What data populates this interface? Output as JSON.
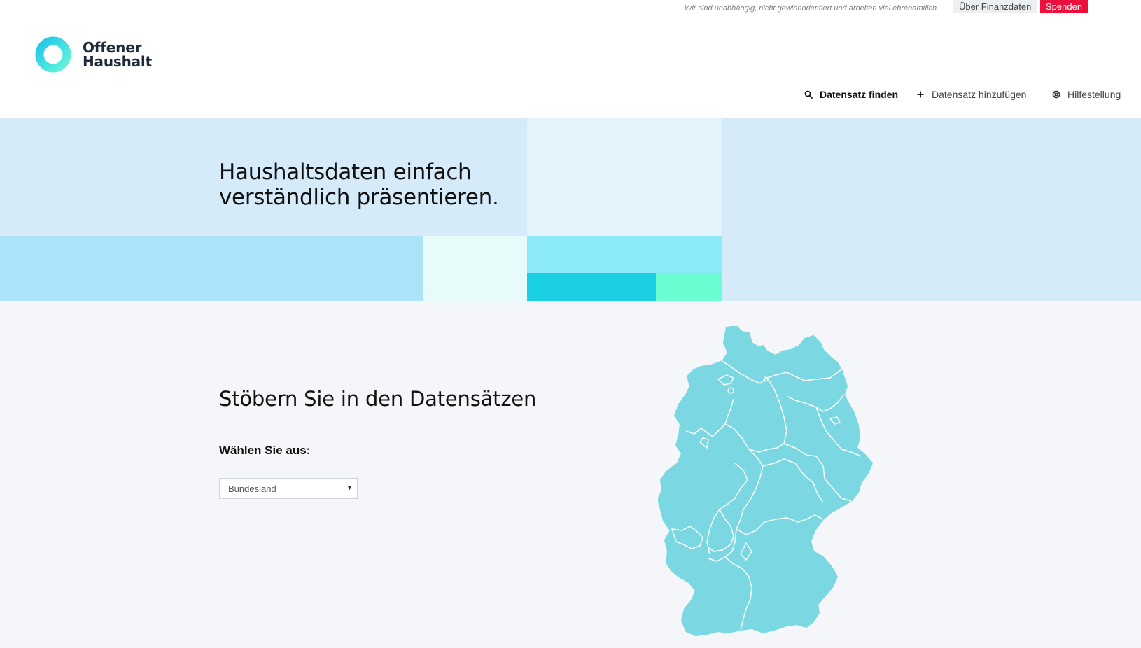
{
  "topbar": {
    "tagline": "Wir sind unabhängig, nicht gewinnorientiert und arbeiten viel ehrenamtlich.",
    "about_label": "Über Finanzdaten",
    "donate_label": "Spenden"
  },
  "logo": {
    "line1": "Offener",
    "line2": "Haushalt"
  },
  "nav": {
    "items": [
      {
        "label": "Datensatz finden",
        "icon": "search-icon",
        "active": true
      },
      {
        "label": "Datensatz hinzufügen",
        "icon": "plus-icon",
        "active": false
      },
      {
        "label": "Hilfestellung",
        "icon": "lifebuoy-icon",
        "active": false
      }
    ]
  },
  "hero": {
    "title_line1": "Haushaltsdaten einfach",
    "title_line2": "verständlich präsentieren."
  },
  "browse": {
    "title": "Stöbern Sie in den Datensätzen",
    "select_label": "Wählen Sie aus:",
    "select_value": "Bundesland"
  },
  "map": {
    "name": "germany-states-map"
  },
  "colors": {
    "accent": "#1ed1e5",
    "donate": "#ec0f3c",
    "map_fill": "#7bd8e3",
    "hero_bg": "#d5ebfa",
    "section_bg": "#f4f6f9"
  }
}
